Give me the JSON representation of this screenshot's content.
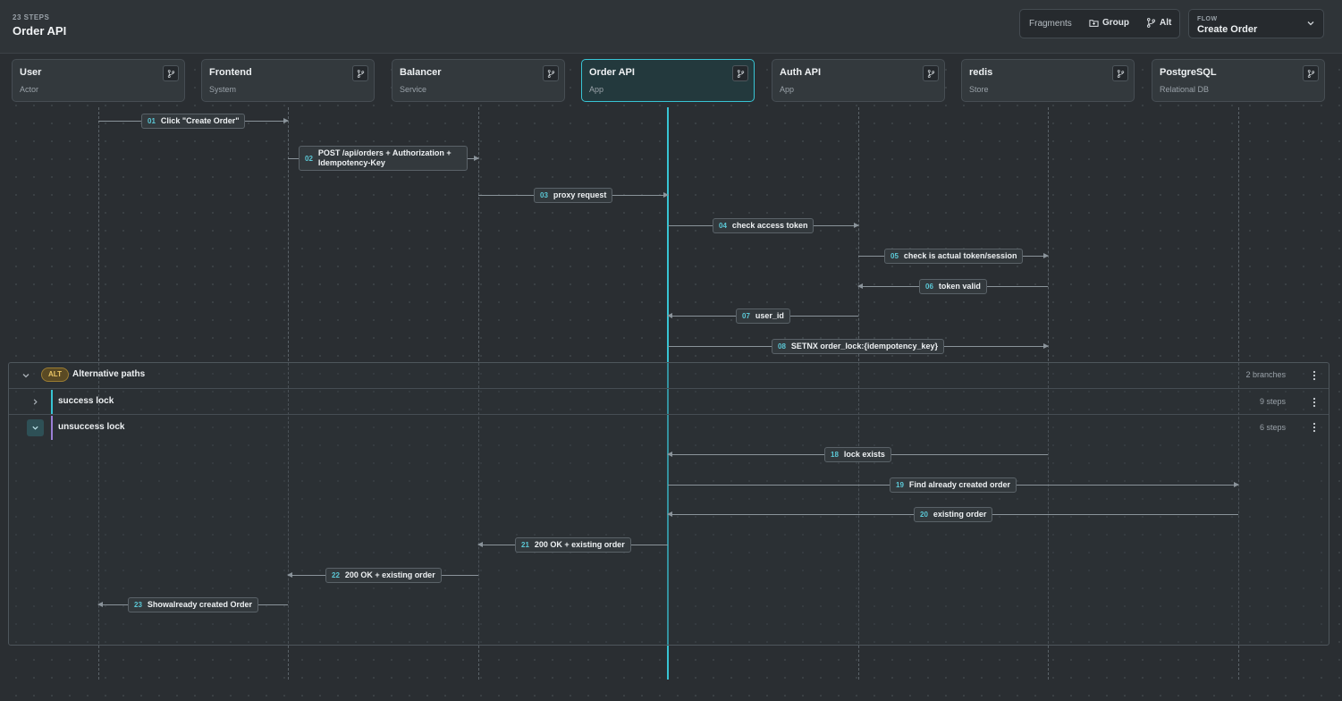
{
  "header": {
    "steps_count": "23 STEPS",
    "title": "Order API",
    "fragments_label": "Fragments",
    "group_label": "Group",
    "alt_label": "Alt",
    "flow_label": "FLOW",
    "flow_value": "Create Order"
  },
  "participants": [
    {
      "name": "User",
      "type": "Actor"
    },
    {
      "name": "Frontend",
      "type": "System"
    },
    {
      "name": "Balancer",
      "type": "Service"
    },
    {
      "name": "Order API",
      "type": "App"
    },
    {
      "name": "Auth API",
      "type": "App"
    },
    {
      "name": "redis",
      "type": "Store"
    },
    {
      "name": "PostgreSQL",
      "type": "Relational DB"
    }
  ],
  "messages": [
    {
      "num": "01",
      "text": "Click \"Create Order\"",
      "from": 0,
      "to": 1
    },
    {
      "num": "02",
      "text": "POST /api/orders + Authorization + Idempotency-Key",
      "from": 1,
      "to": 2
    },
    {
      "num": "03",
      "text": "proxy request",
      "from": 2,
      "to": 3
    },
    {
      "num": "04",
      "text": "check access token",
      "from": 3,
      "to": 4
    },
    {
      "num": "05",
      "text": "check is actual token/session",
      "from": 4,
      "to": 5
    },
    {
      "num": "06",
      "text": "token valid",
      "from": 5,
      "to": 4
    },
    {
      "num": "07",
      "text": "user_id",
      "from": 4,
      "to": 3
    },
    {
      "num": "08",
      "text": "SETNX order_lock:{idempotency_key}",
      "from": 3,
      "to": 5
    },
    {
      "num": "18",
      "text": "lock exists",
      "from": 5,
      "to": 3
    },
    {
      "num": "19",
      "text": "Find already created order",
      "from": 3,
      "to": 6
    },
    {
      "num": "20",
      "text": "existing order",
      "from": 6,
      "to": 3
    },
    {
      "num": "21",
      "text": "200 OK + existing order",
      "from": 3,
      "to": 2
    },
    {
      "num": "22",
      "text": "200 OK + existing order",
      "from": 2,
      "to": 1
    },
    {
      "num": "23",
      "text": "Showalready created Order",
      "from": 1,
      "to": 0
    }
  ],
  "alt_fragment": {
    "badge": "ALT",
    "title": "Alternative paths",
    "meta": "2 branches",
    "branches": [
      {
        "name": "success lock",
        "meta": "9 steps",
        "color": "#38c4d4",
        "expanded": false
      },
      {
        "name": "unsuccess lock",
        "meta": "6 steps",
        "color": "#9b7fd6",
        "expanded": true
      }
    ]
  },
  "colors": {
    "accent": "#38c4d4",
    "alt_badge": "#e8c565"
  }
}
